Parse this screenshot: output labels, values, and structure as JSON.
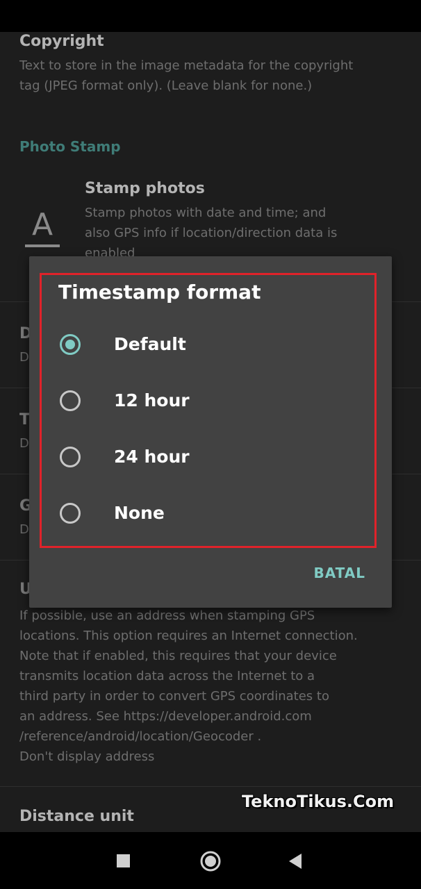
{
  "settings": {
    "copyright": {
      "title": "Copyright",
      "summary": "Text to store in the image metadata for the copyright\ntag (JPEG format only). (Leave blank for none.)"
    },
    "category_photo_stamp": "Photo Stamp",
    "stamp_photos": {
      "title": "Stamp photos",
      "summary": "Stamp photos with date and time; and\nalso GPS info if location/direction data is\nenabled"
    },
    "hidden_rows": [
      {
        "title_initial": "D",
        "summary_initial": "D"
      },
      {
        "title_initial": "T",
        "summary_initial": "D"
      },
      {
        "title_initial": "G",
        "summary_initial": "D"
      },
      {
        "title_initial": "U"
      }
    ],
    "address": {
      "summary": "If possible, use an address when stamping GPS\nlocations. This option requires an Internet connection.\nNote that if enabled, this requires that your device\ntransmits location data across the Internet to a\nthird party in order to convert GPS coordinates to\nan address. See https://developer.android.com\n/reference/android/location/Geocoder .\nDon't display address"
    },
    "distance_unit": {
      "title": "Distance unit"
    }
  },
  "dialog": {
    "title": "Timestamp format",
    "options": [
      {
        "label": "Default",
        "selected": true
      },
      {
        "label": "12 hour",
        "selected": false
      },
      {
        "label": "24 hour",
        "selected": false
      },
      {
        "label": "None",
        "selected": false
      }
    ],
    "cancel_label": "BATAL"
  },
  "watermark": "TeknoTikus.Com",
  "colors": {
    "accent": "#80cbc4",
    "highlight": "#e0222a",
    "dialog_bg": "#424242",
    "background": "#1d1d1d"
  },
  "icons": {
    "stamp": "text-format-icon",
    "nav_recents": "square-icon",
    "nav_home": "circle-icon",
    "nav_back": "triangle-back-icon"
  }
}
